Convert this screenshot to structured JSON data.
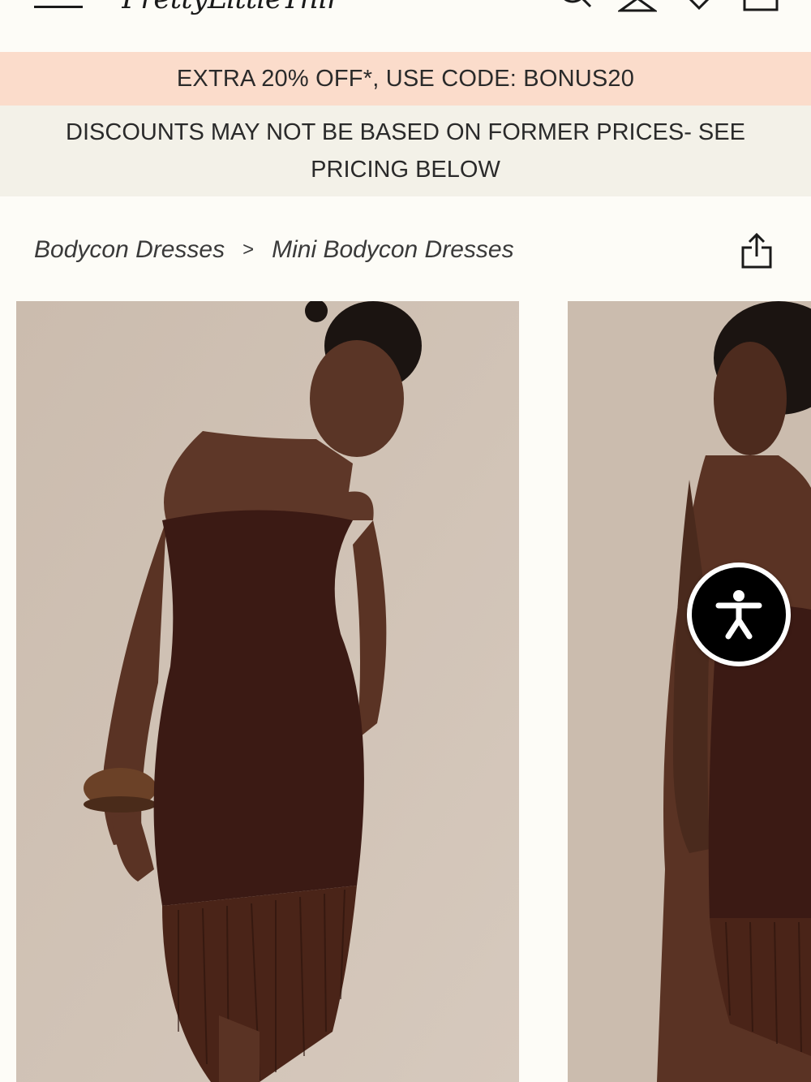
{
  "header": {
    "logo_text": "PrettyLittleThing",
    "icons": [
      "menu-icon",
      "search-icon",
      "account-icon",
      "wishlist-heart-icon",
      "bag-icon"
    ]
  },
  "promo": {
    "text": "EXTRA 20% OFF*, USE CODE: BONUS20",
    "background": "#fbdccb"
  },
  "disclaimer": {
    "text": "DISCOUNTS MAY NOT BE BASED ON FORMER PRICES- SEE PRICING BELOW",
    "background": "#f3f1e8"
  },
  "breadcrumb": {
    "items": [
      "Bodycon Dresses",
      "Mini Bodycon Dresses"
    ],
    "separator": ">"
  },
  "actions": {
    "share_icon": "share-icon",
    "accessibility_icon": "accessibility-icon"
  },
  "gallery": {
    "image_count_visible": 2,
    "dress_color": "#3b1a14",
    "background_color": "#cfc1b4"
  }
}
